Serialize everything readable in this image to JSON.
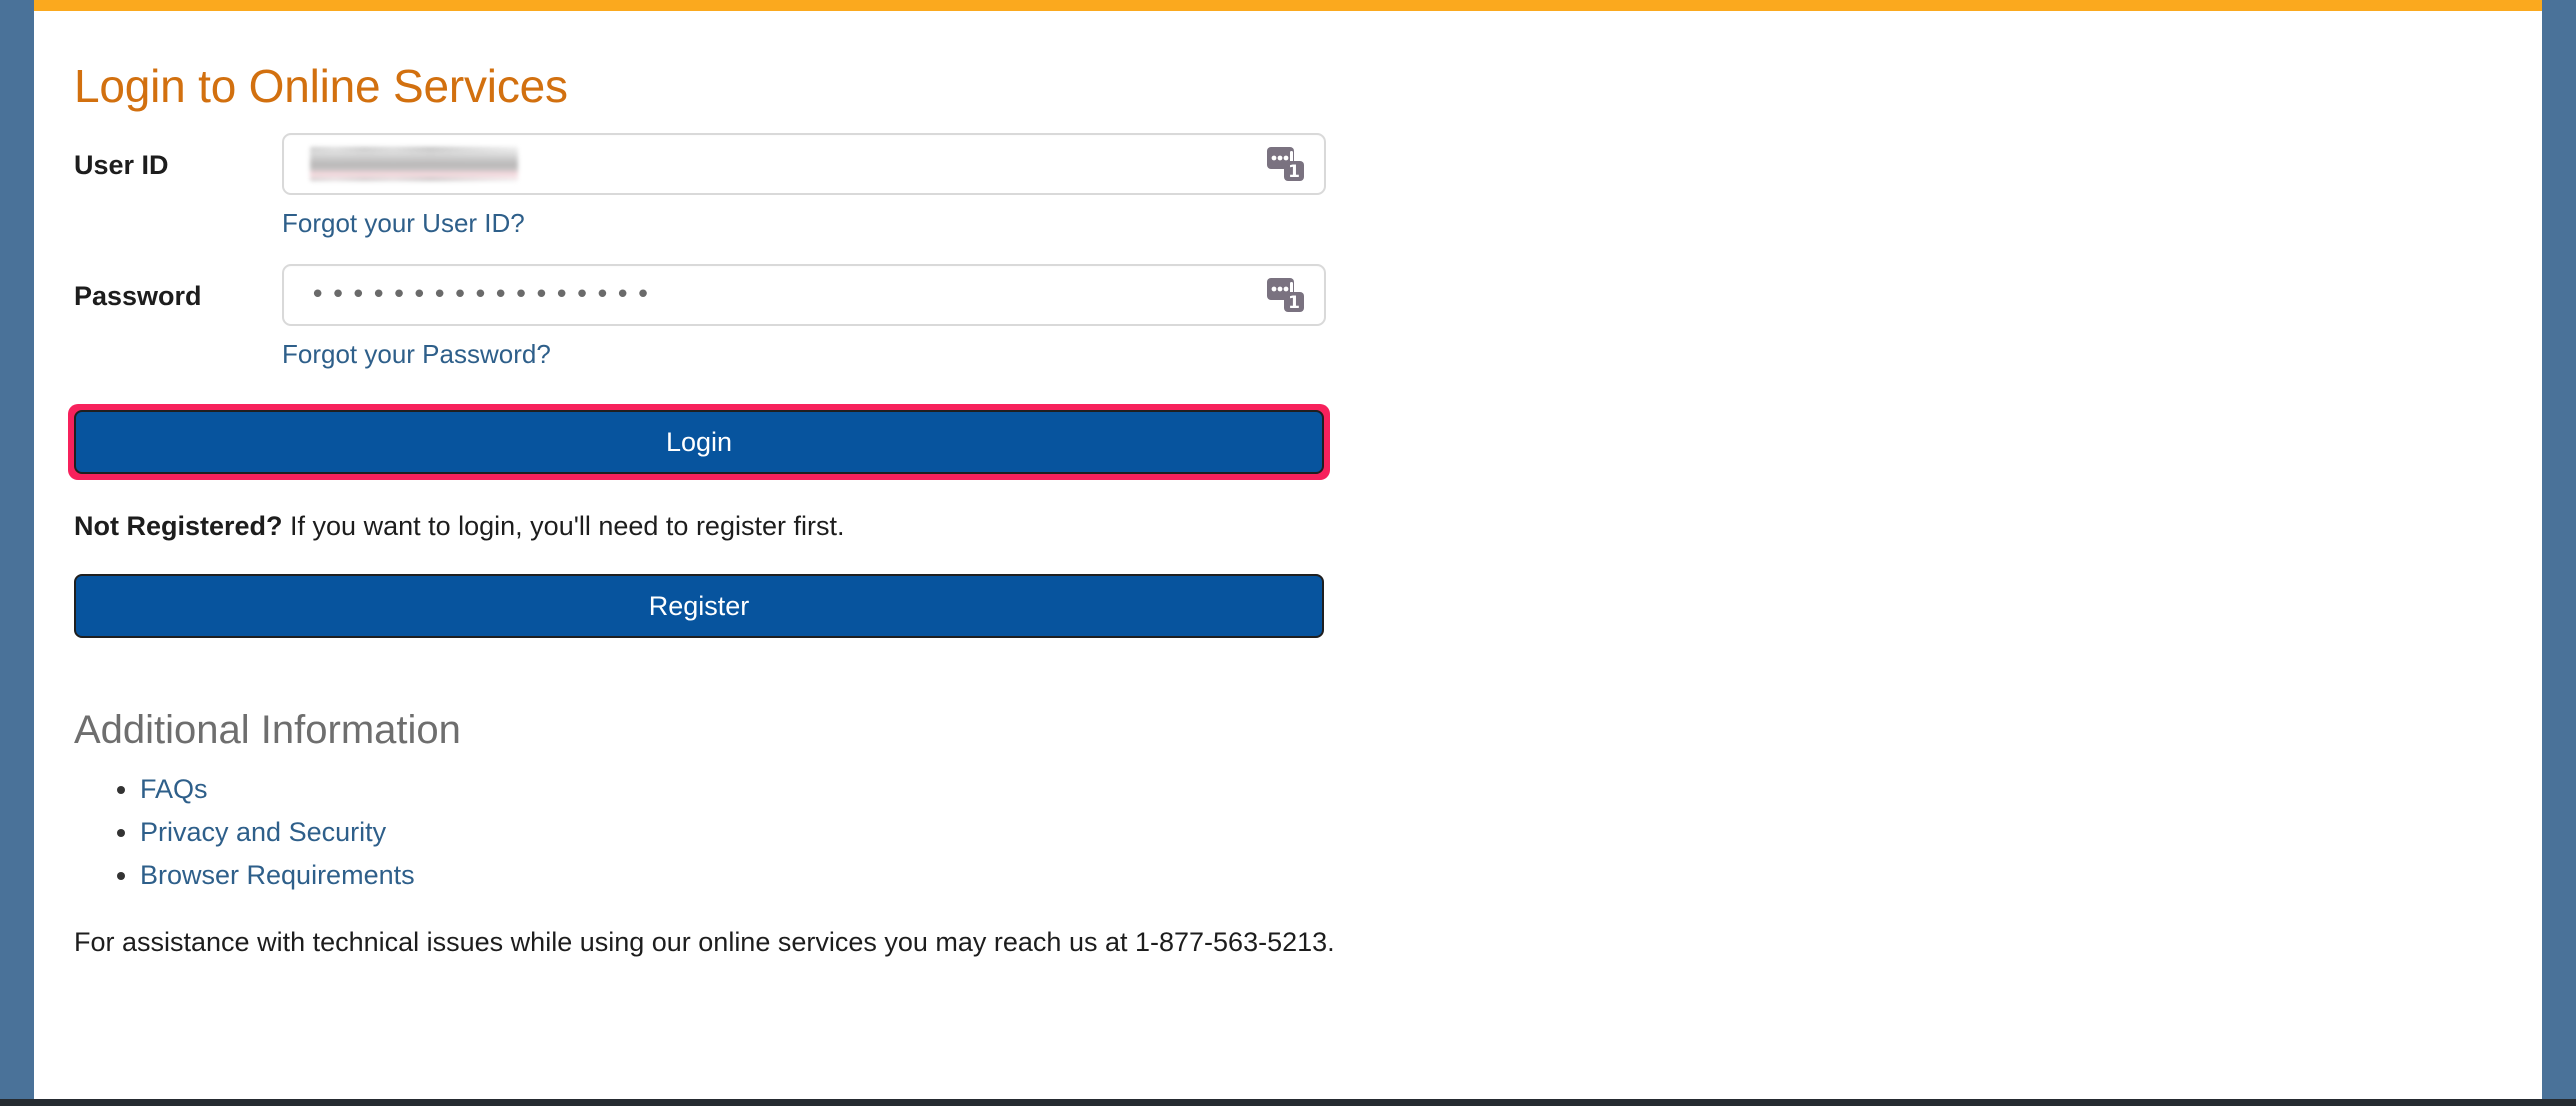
{
  "theme": {
    "accent_orange": "#fba91e",
    "title_orange": "#d2700f",
    "edge_blue": "#4a7299",
    "button_blue": "#07549e",
    "link_blue": "#2e5f8a",
    "highlight_pink": "#f7215c",
    "heading_gray": "#6e6e6e"
  },
  "page": {
    "title": "Login to Online Services"
  },
  "form": {
    "user_id": {
      "label": "User ID",
      "value": "",
      "placeholder": "",
      "redacted": true,
      "forgot_link": "Forgot your User ID?",
      "autofill_badge": "1"
    },
    "password": {
      "label": "Password",
      "value": "•••••••••••••••••",
      "placeholder": "",
      "forgot_link": "Forgot your Password?",
      "autofill_badge": "1"
    },
    "login_button": "Login",
    "register_button": "Register"
  },
  "not_registered": {
    "lead": "Not Registered?",
    "rest": " If you want to login, you'll need to register first."
  },
  "additional_information": {
    "heading": "Additional Information",
    "links": [
      {
        "label": "FAQs"
      },
      {
        "label": "Privacy and Security"
      },
      {
        "label": "Browser Requirements"
      }
    ]
  },
  "assistance": {
    "text": "For assistance with technical issues while using our online services you may reach us at 1-877-563-5213.",
    "phone": "1-877-563-5213"
  }
}
